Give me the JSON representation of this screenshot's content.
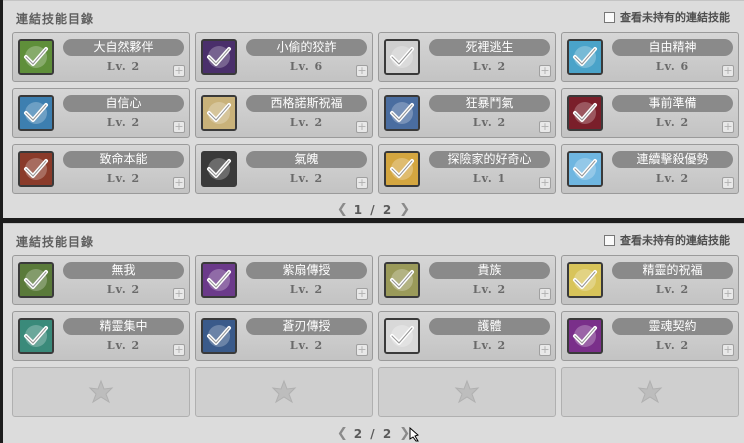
{
  "title": "連結技能目錄",
  "toggle_label": "查看未持有的連結技能",
  "level_prefix": "Lv.",
  "plus_glyph": "+",
  "prev_glyph": "❮",
  "next_glyph": "❯",
  "pages": [
    {
      "title": "連結技能目錄",
      "page_indicator": "1 / 2",
      "skills": [
        {
          "name": "大自然夥伴",
          "level": "Lv. 2",
          "icon": "nature-partner-icon",
          "color": "#5f8f3a"
        },
        {
          "name": "小偷的狡詐",
          "level": "Lv. 6",
          "icon": "thief-cunning-icon",
          "color": "#4a2f6b"
        },
        {
          "name": "死裡逃生",
          "level": "Lv. 2",
          "icon": "narrow-escape-icon",
          "color": "#cfcfcf"
        },
        {
          "name": "自由精神",
          "level": "Lv. 6",
          "icon": "spirit-of-freedom-icon",
          "color": "#4aa3c9"
        },
        {
          "name": "自信心",
          "level": "Lv. 2",
          "icon": "self-confidence-icon",
          "color": "#3d7fb0"
        },
        {
          "name": "西格諾斯祝福",
          "level": "Lv. 2",
          "icon": "cygnus-blessing-icon",
          "color": "#c9b27a"
        },
        {
          "name": "狂暴鬥氣",
          "level": "Lv. 2",
          "icon": "fury-unleashed-icon",
          "color": "#4a6da0"
        },
        {
          "name": "事前準備",
          "level": "Lv. 2",
          "icon": "preparation-icon",
          "color": "#7a1f2a"
        },
        {
          "name": "致命本能",
          "level": "Lv. 2",
          "icon": "deadly-instinct-icon",
          "color": "#8a3b2a"
        },
        {
          "name": "氣魄",
          "level": "Lv. 2",
          "icon": "spirit-icon",
          "color": "#3a3a3a"
        },
        {
          "name": "探險家的好奇心",
          "level": "Lv. 1",
          "icon": "explorer-curiosity-icon",
          "color": "#d4a640"
        },
        {
          "name": "連續擊殺優勢",
          "level": "Lv. 2",
          "icon": "combo-kill-icon",
          "color": "#6fb6e0"
        }
      ],
      "empty_slots": 0
    },
    {
      "title": "連結技能目錄",
      "page_indicator": "2 / 2",
      "skills": [
        {
          "name": "無我",
          "level": "Lv. 2",
          "icon": "selflessness-icon",
          "color": "#5a7a3a"
        },
        {
          "name": "紫扇傳授",
          "level": "Lv. 2",
          "icon": "purple-fan-icon",
          "color": "#6b3a8a"
        },
        {
          "name": "貴族",
          "level": "Lv. 2",
          "icon": "noble-icon",
          "color": "#9a9a5a"
        },
        {
          "name": "精靈的祝福",
          "level": "Lv. 2",
          "icon": "elven-blessing-icon",
          "color": "#d8c45a"
        },
        {
          "name": "精靈集中",
          "level": "Lv. 2",
          "icon": "elemental-focus-icon",
          "color": "#3a8a7a"
        },
        {
          "name": "蒼刃傳授",
          "level": "Lv. 2",
          "icon": "blue-blade-icon",
          "color": "#3a5a8a"
        },
        {
          "name": "護體",
          "level": "Lv. 2",
          "icon": "body-guard-icon",
          "color": "#d8d8d8"
        },
        {
          "name": "靈魂契約",
          "level": "Lv. 2",
          "icon": "soul-contract-icon",
          "color": "#7a2f8a"
        }
      ],
      "empty_slots": 4
    }
  ]
}
